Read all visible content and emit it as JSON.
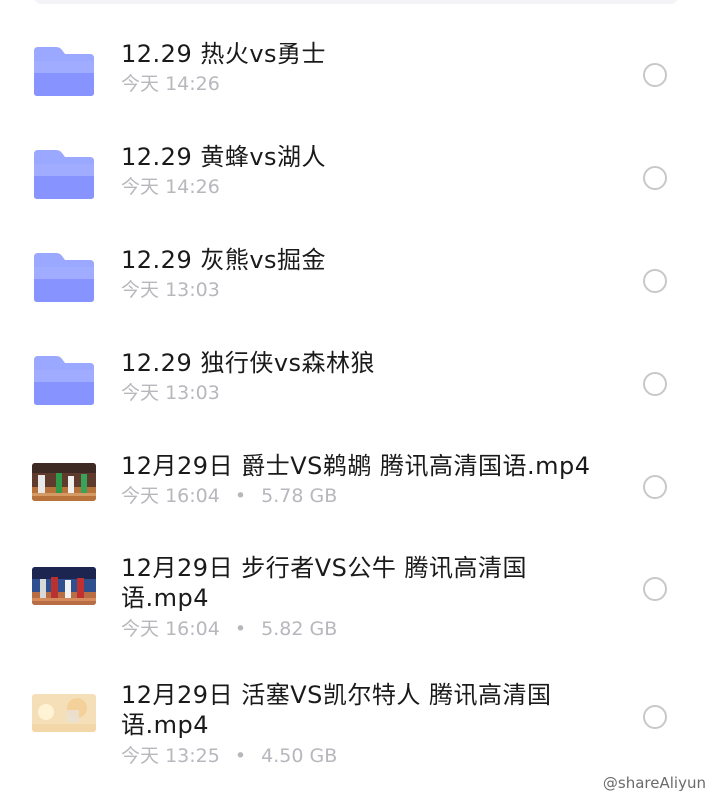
{
  "files": [
    {
      "kind": "folder",
      "title": "12.29 热火vs勇士",
      "date": "今天",
      "time": "14:26",
      "size": ""
    },
    {
      "kind": "folder",
      "title": "12.29 黄蜂vs湖人",
      "date": "今天",
      "time": "14:26",
      "size": ""
    },
    {
      "kind": "folder",
      "title": "12.29 灰熊vs掘金",
      "date": "今天",
      "time": "13:03",
      "size": ""
    },
    {
      "kind": "folder",
      "title": "12.29 独行侠vs森林狼",
      "date": "今天",
      "time": "13:03",
      "size": ""
    },
    {
      "kind": "video",
      "title": "12月29日 爵士VS鹈鹕 腾讯高清国语.mp4",
      "date": "今天",
      "time": "16:04",
      "size": "5.78 GB"
    },
    {
      "kind": "video",
      "title": "12月29日 步行者VS公牛 腾讯高清国语.mp4",
      "date": "今天",
      "time": "16:04",
      "size": "5.82 GB"
    },
    {
      "kind": "video",
      "title": "12月29日 活塞VS凯尔特人 腾讯高清国语.mp4",
      "date": "今天",
      "time": "13:25",
      "size": "4.50 GB"
    }
  ],
  "meta_separator": "•",
  "watermark": "@shareAliyun",
  "colors": {
    "folder_light": "#a9b6ff",
    "folder_dark": "#7f8cff",
    "title": "#1a1a1a",
    "meta": "#b7b7bd",
    "select_border": "#c8c8cc"
  }
}
